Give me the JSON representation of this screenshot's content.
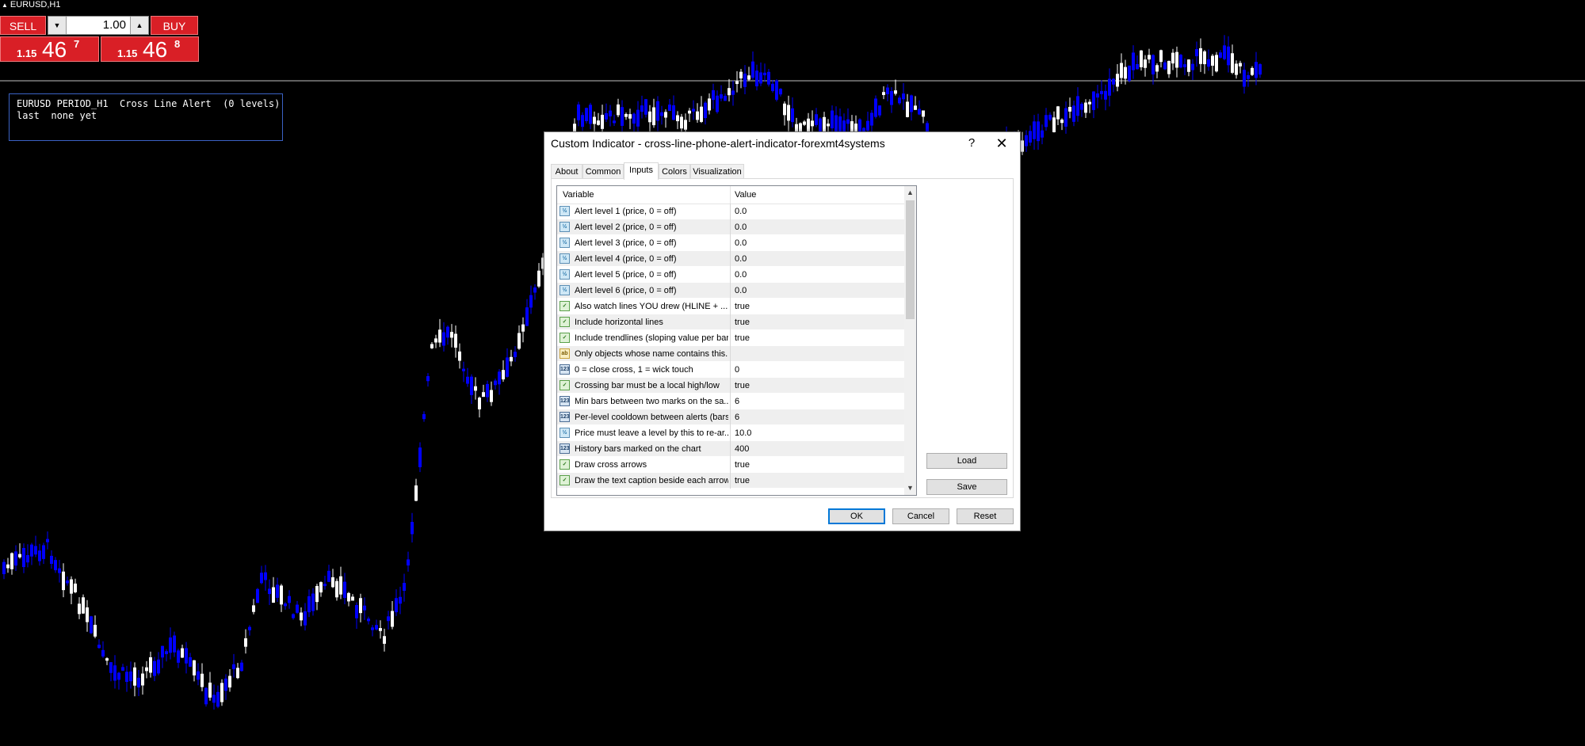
{
  "chart": {
    "symbol_title": "EURUSD,H1",
    "colors": {
      "background": "#000000",
      "bull_candle": "#ffffff",
      "bear_candle": "#0000ff",
      "price_line": "#c0c0c0"
    }
  },
  "trade_panel": {
    "sell_label": "SELL",
    "buy_label": "BUY",
    "lot_value": "1.00",
    "lot_down_icon": "triangle-down-icon",
    "lot_up_icon": "triangle-up-icon",
    "sell_price": {
      "prefix": "1.15",
      "big": "46",
      "pip": "7"
    },
    "buy_price": {
      "prefix": "1.15",
      "big": "46",
      "pip": "8"
    },
    "color": "#d91f26"
  },
  "alert_box": {
    "line1": "EURUSD PERIOD_H1  Cross Line Alert  (0 levels)",
    "line2": "last  none yet",
    "border_color": "#3b62c4"
  },
  "dialog": {
    "title": "Custom Indicator - cross-line-phone-alert-indicator-forexmt4systems",
    "help_label": "?",
    "close_label": "✕",
    "tabs": [
      {
        "label": "About"
      },
      {
        "label": "Common"
      },
      {
        "label": "Inputs",
        "active": true
      },
      {
        "label": "Colors"
      },
      {
        "label": "Visualization"
      }
    ],
    "grid": {
      "header_variable": "Variable",
      "header_value": "Value",
      "rows": [
        {
          "type": "num",
          "icon_text": "½",
          "name": "Alert level 1 (price, 0 = off)",
          "value": "0.0"
        },
        {
          "type": "num",
          "icon_text": "½",
          "name": "Alert level 2 (price, 0 = off)",
          "value": "0.0"
        },
        {
          "type": "num",
          "icon_text": "½",
          "name": "Alert level 3 (price, 0 = off)",
          "value": "0.0"
        },
        {
          "type": "num",
          "icon_text": "½",
          "name": "Alert level 4 (price, 0 = off)",
          "value": "0.0"
        },
        {
          "type": "num",
          "icon_text": "½",
          "name": "Alert level 5 (price, 0 = off)",
          "value": "0.0"
        },
        {
          "type": "num",
          "icon_text": "½",
          "name": "Alert level 6 (price, 0 = off)",
          "value": "0.0"
        },
        {
          "type": "bool",
          "icon_text": "✓",
          "name": "Also watch lines YOU drew (HLINE + ...",
          "value": "true"
        },
        {
          "type": "bool",
          "icon_text": "✓",
          "name": "Include horizontal lines",
          "value": "true"
        },
        {
          "type": "bool",
          "icon_text": "✓",
          "name": "Include trendlines (sloping value per bar)",
          "value": "true"
        },
        {
          "type": "str",
          "icon_text": "ab",
          "name": "Only objects whose name contains this...",
          "value": ""
        },
        {
          "type": "int",
          "icon_text": "123",
          "name": "0 = close cross, 1 = wick touch",
          "value": "0"
        },
        {
          "type": "bool",
          "icon_text": "✓",
          "name": "Crossing bar must be a local high/low",
          "value": "true"
        },
        {
          "type": "int",
          "icon_text": "123",
          "name": "Min bars between two marks on the sa...",
          "value": "6"
        },
        {
          "type": "int",
          "icon_text": "123",
          "name": "Per-level cooldown between alerts (bars)",
          "value": "6"
        },
        {
          "type": "num",
          "icon_text": "½",
          "name": "Price must leave a level by this to re-ar...",
          "value": "10.0"
        },
        {
          "type": "int",
          "icon_text": "123",
          "name": "History bars marked on the chart",
          "value": "400"
        },
        {
          "type": "bool",
          "icon_text": "✓",
          "name": "Draw cross arrows",
          "value": "true"
        },
        {
          "type": "bool",
          "icon_text": "✓",
          "name": "Draw the text caption beside each arrow",
          "value": "true"
        }
      ]
    },
    "load_label": "Load",
    "save_label": "Save",
    "ok_label": "OK",
    "cancel_label": "Cancel",
    "reset_label": "Reset"
  }
}
